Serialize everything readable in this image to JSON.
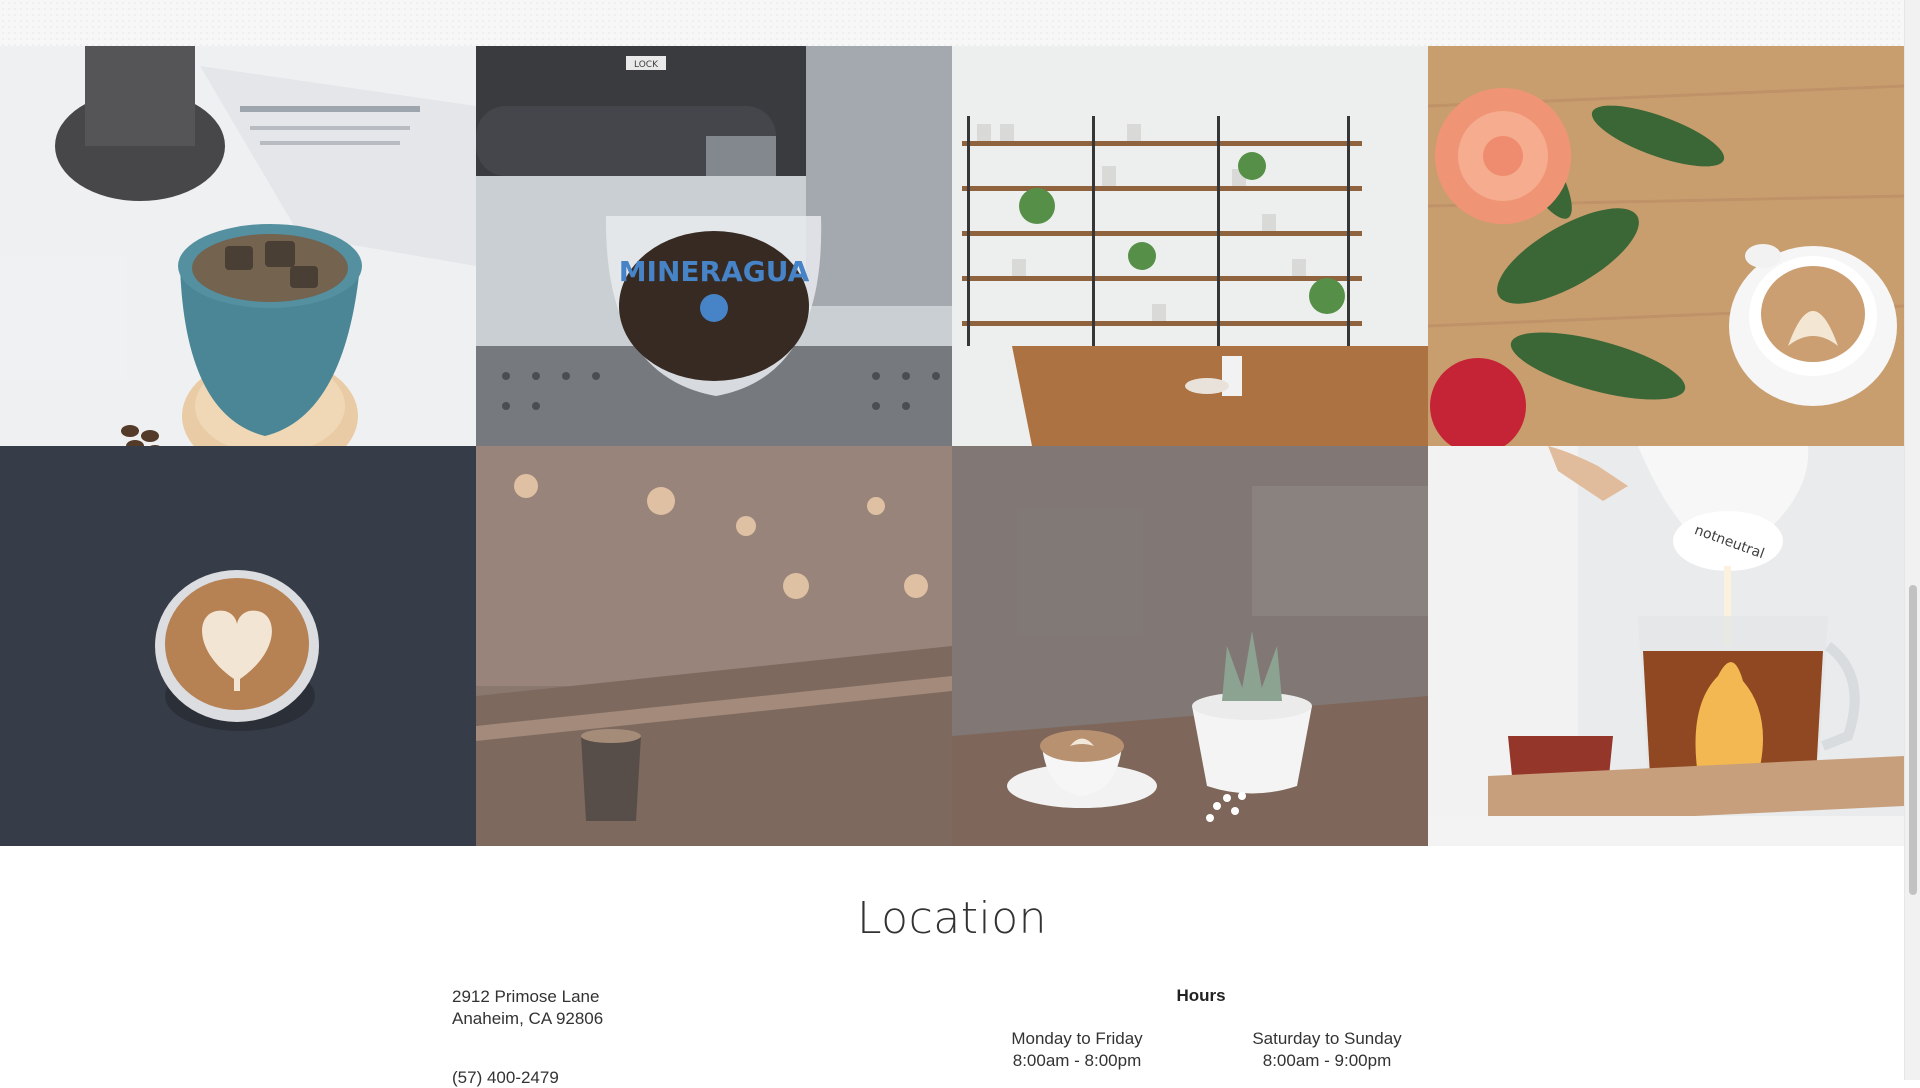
{
  "gallery": {
    "images": [
      {
        "name": "iced-coffee-blue-cup-image"
      },
      {
        "name": "espresso-machine-glass-image"
      },
      {
        "name": "cafe-shelves-interior-image"
      },
      {
        "name": "latte-with-roses-image"
      },
      {
        "name": "latte-heart-art-image"
      },
      {
        "name": "dim-bar-espresso-image"
      },
      {
        "name": "latte-with-succulent-image"
      },
      {
        "name": "milk-pouring-tea-image"
      }
    ],
    "image_texts": {
      "mug_brand": "MINERAGUA",
      "pitcher_brand": "notneutral",
      "machine_label": "LOCK"
    }
  },
  "location": {
    "title": "Location",
    "address_line1": "2912 Primose Lane",
    "address_line2": "Anaheim, CA 92806",
    "phone": "(57) 400-2479",
    "hours_title": "Hours",
    "weekday_label": "Monday to Friday",
    "weekday_hours": "8:00am - 8:00pm",
    "weekend_label": "Saturday to Sunday",
    "weekend_hours": "8:00am - 9:00pm"
  },
  "colors": {
    "text": "#333333",
    "page_bg": "#ffffff",
    "top_band": "#f7f7f7"
  }
}
